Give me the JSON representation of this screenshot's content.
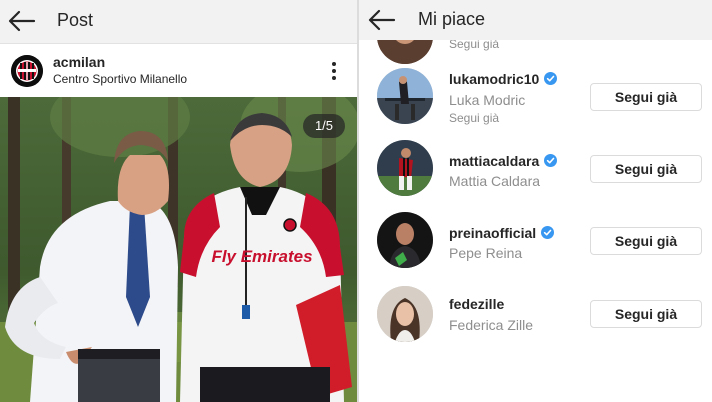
{
  "left_screen": {
    "title": "Post",
    "post": {
      "username": "acmilan",
      "location": "Centro Sportivo Milanello",
      "image_counter": "1/5",
      "shirt_text": "Fly Emirates"
    }
  },
  "right_screen": {
    "title": "Mi piace",
    "users": [
      {
        "username": "",
        "full_name": "",
        "follows_text": "Segui già",
        "verified": false,
        "button": ""
      },
      {
        "username": "lukamodric10",
        "full_name": "Luka Modric",
        "follows_text": "Segui già",
        "verified": true,
        "button": "Segui già"
      },
      {
        "username": "mattiacaldara",
        "full_name": "Mattia Caldara",
        "follows_text": "",
        "verified": true,
        "button": "Segui già"
      },
      {
        "username": "preinaofficial",
        "full_name": "Pepe Reina",
        "follows_text": "",
        "verified": true,
        "button": "Segui già"
      },
      {
        "username": "fedezille",
        "full_name": "Federica Zille",
        "follows_text": "",
        "verified": false,
        "button": "Segui già"
      }
    ]
  },
  "colors": {
    "topbar": "#f2f2f2",
    "text": "#262626",
    "secondary_text": "#8e8e8e",
    "verified_badge": "#3897f0",
    "button_border": "#dbdbdb"
  },
  "icons": [
    "back-arrow-icon",
    "more-options-icon",
    "verified-badge-icon",
    "acmilan-logo-icon"
  ]
}
